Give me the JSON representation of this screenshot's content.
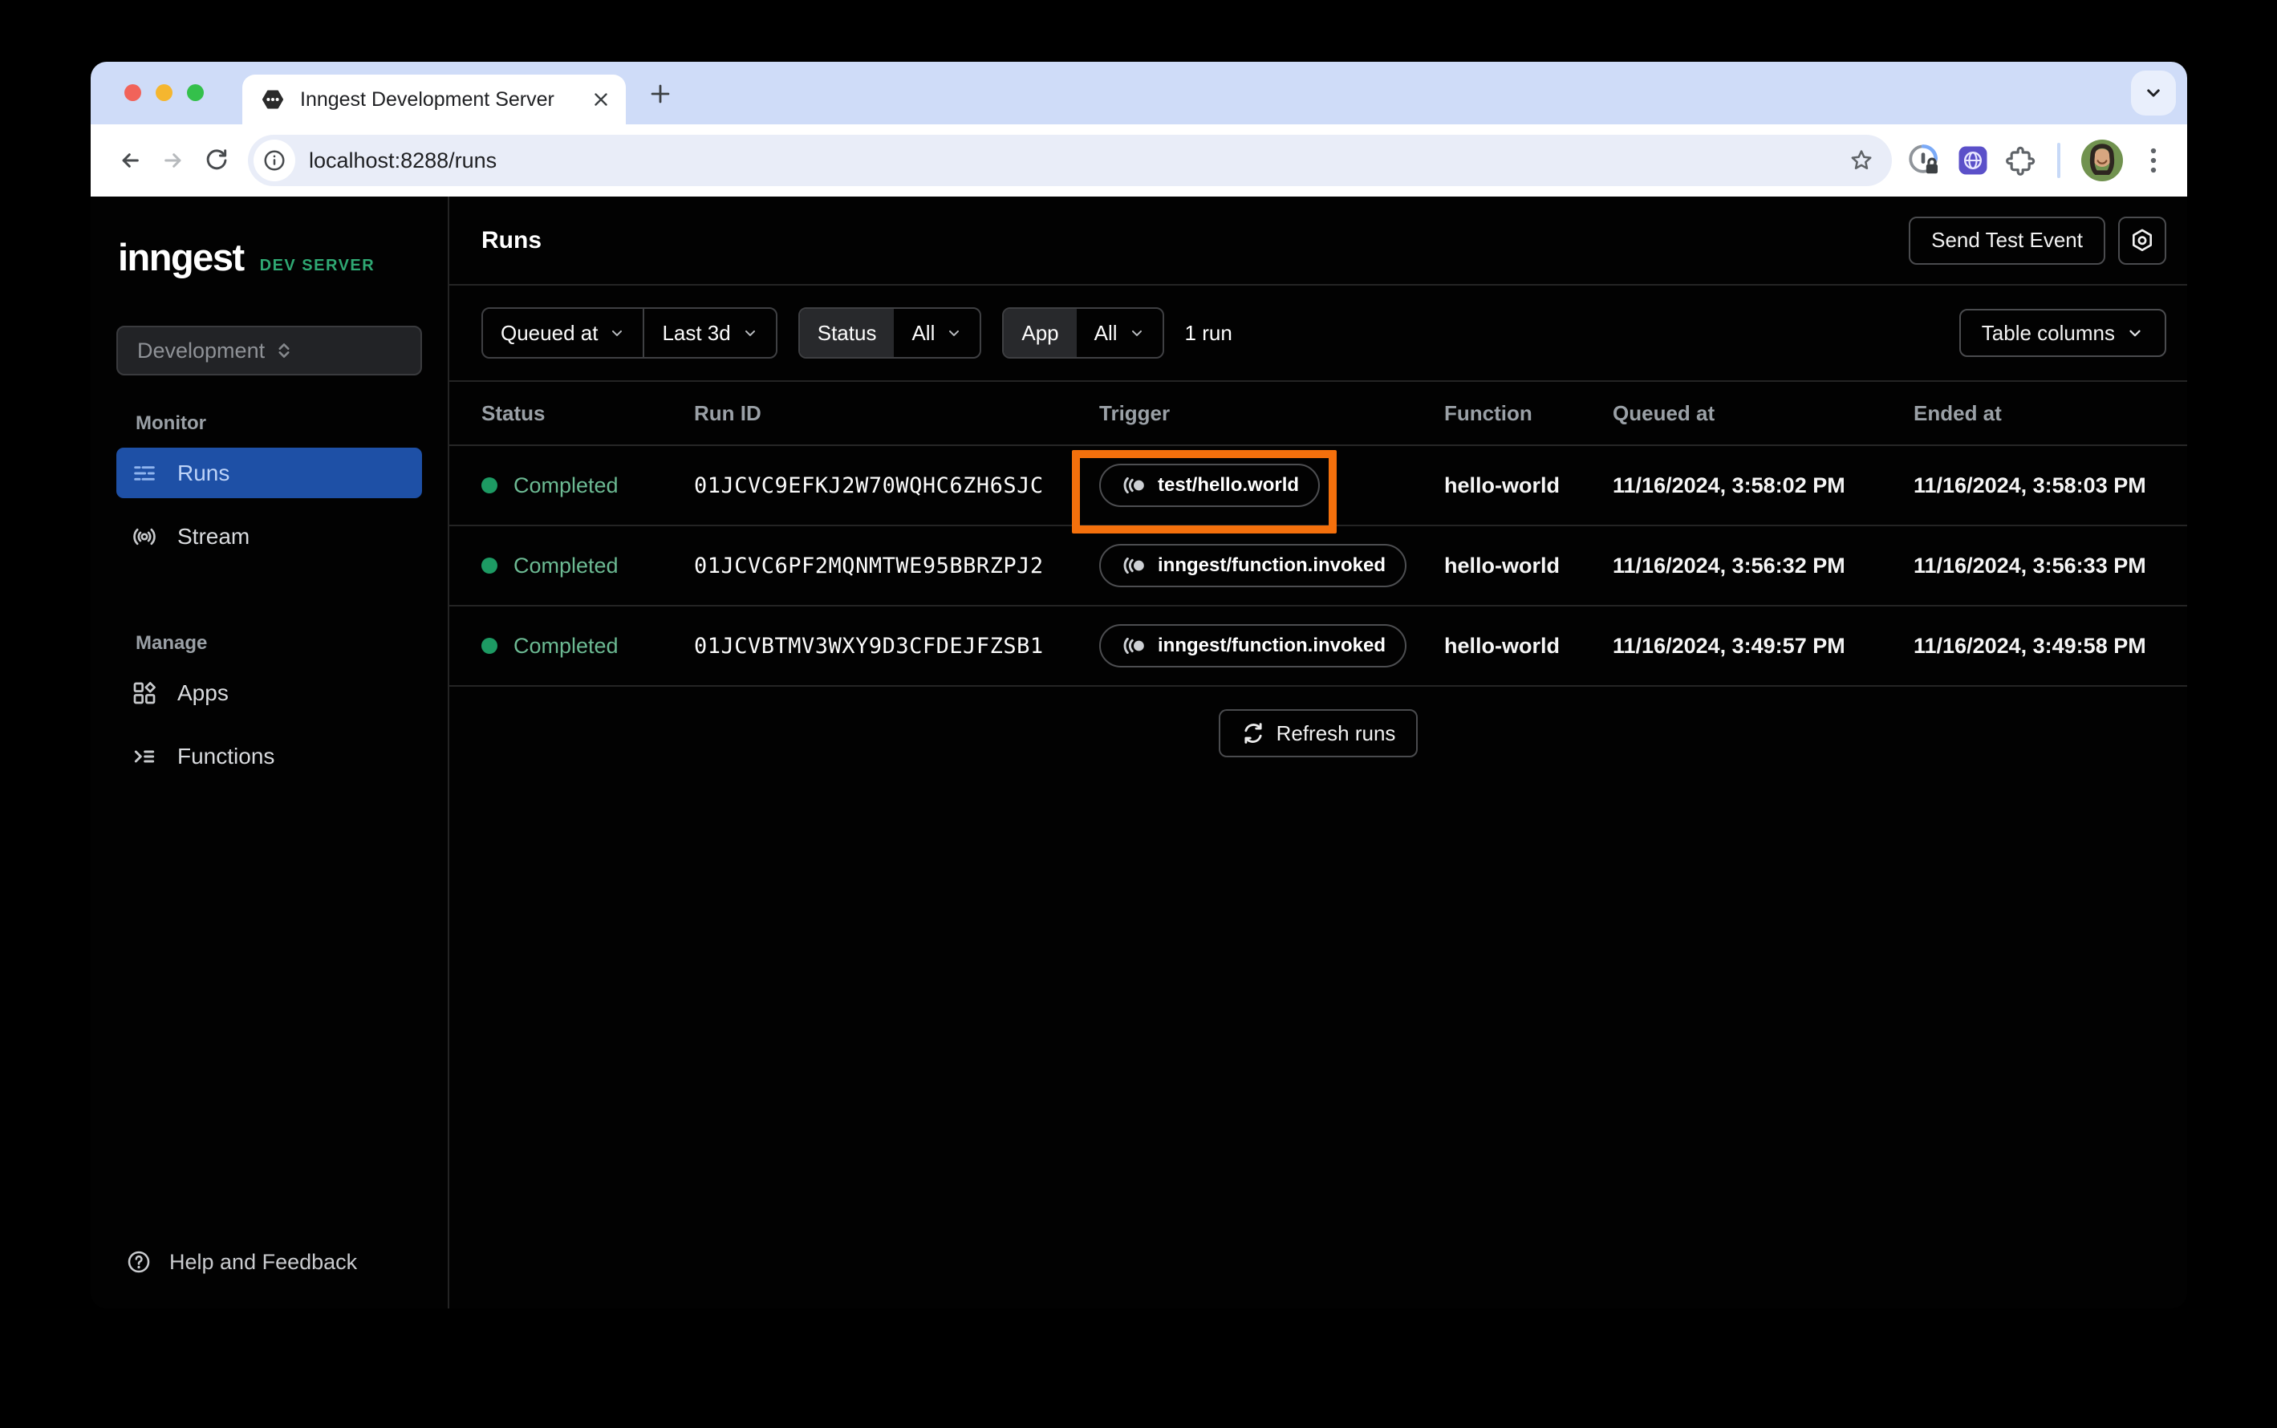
{
  "browser": {
    "tab_title": "Inngest Development Server",
    "url": "localhost:8288/runs"
  },
  "sidebar": {
    "logo_text": "inngest",
    "logo_badge": "DEV SERVER",
    "environment": "Development",
    "monitor_label": "Monitor",
    "manage_label": "Manage",
    "items": {
      "runs": "Runs",
      "stream": "Stream",
      "apps": "Apps",
      "functions": "Functions"
    },
    "help_label": "Help and Feedback"
  },
  "page": {
    "title": "Runs",
    "send_test_event_label": "Send Test Event"
  },
  "filters": {
    "time_field": "Queued at",
    "time_range": "Last 3d",
    "status_label": "Status",
    "status_value": "All",
    "app_label": "App",
    "app_value": "All",
    "result_count": "1 run",
    "table_columns_label": "Table columns"
  },
  "table": {
    "columns": [
      "Status",
      "Run ID",
      "Trigger",
      "Function",
      "Queued at",
      "Ended at"
    ],
    "rows": [
      {
        "status": "Completed",
        "run_id": "01JCVC9EFKJ2W70WQHC6ZH6SJC",
        "trigger": "test/hello.world",
        "function": "hello-world",
        "queued_at": "11/16/2024, 3:58:02 PM",
        "ended_at": "11/16/2024, 3:58:03 PM",
        "highlighted": true
      },
      {
        "status": "Completed",
        "run_id": "01JCVC6PF2MQNMTWE95BBRZPJ2",
        "trigger": "inngest/function.invoked",
        "function": "hello-world",
        "queued_at": "11/16/2024, 3:56:32 PM",
        "ended_at": "11/16/2024, 3:56:33 PM",
        "highlighted": false
      },
      {
        "status": "Completed",
        "run_id": "01JCVBTMV3WXY9D3CFDEJFZSB1",
        "trigger": "inngest/function.invoked",
        "function": "hello-world",
        "queued_at": "11/16/2024, 3:49:57 PM",
        "ended_at": "11/16/2024, 3:49:58 PM",
        "highlighted": false
      }
    ],
    "refresh_label": "Refresh runs"
  },
  "colors": {
    "accent_blue": "#1e50a6",
    "success_green": "#1d9a63",
    "brand_green": "#2fa873",
    "highlight_orange": "#f4700c"
  },
  "icons": {
    "favicon": "inngest-hexagon",
    "trigger": "event-pulse",
    "settings": "hexagon-gear",
    "refresh": "circular-arrows"
  }
}
